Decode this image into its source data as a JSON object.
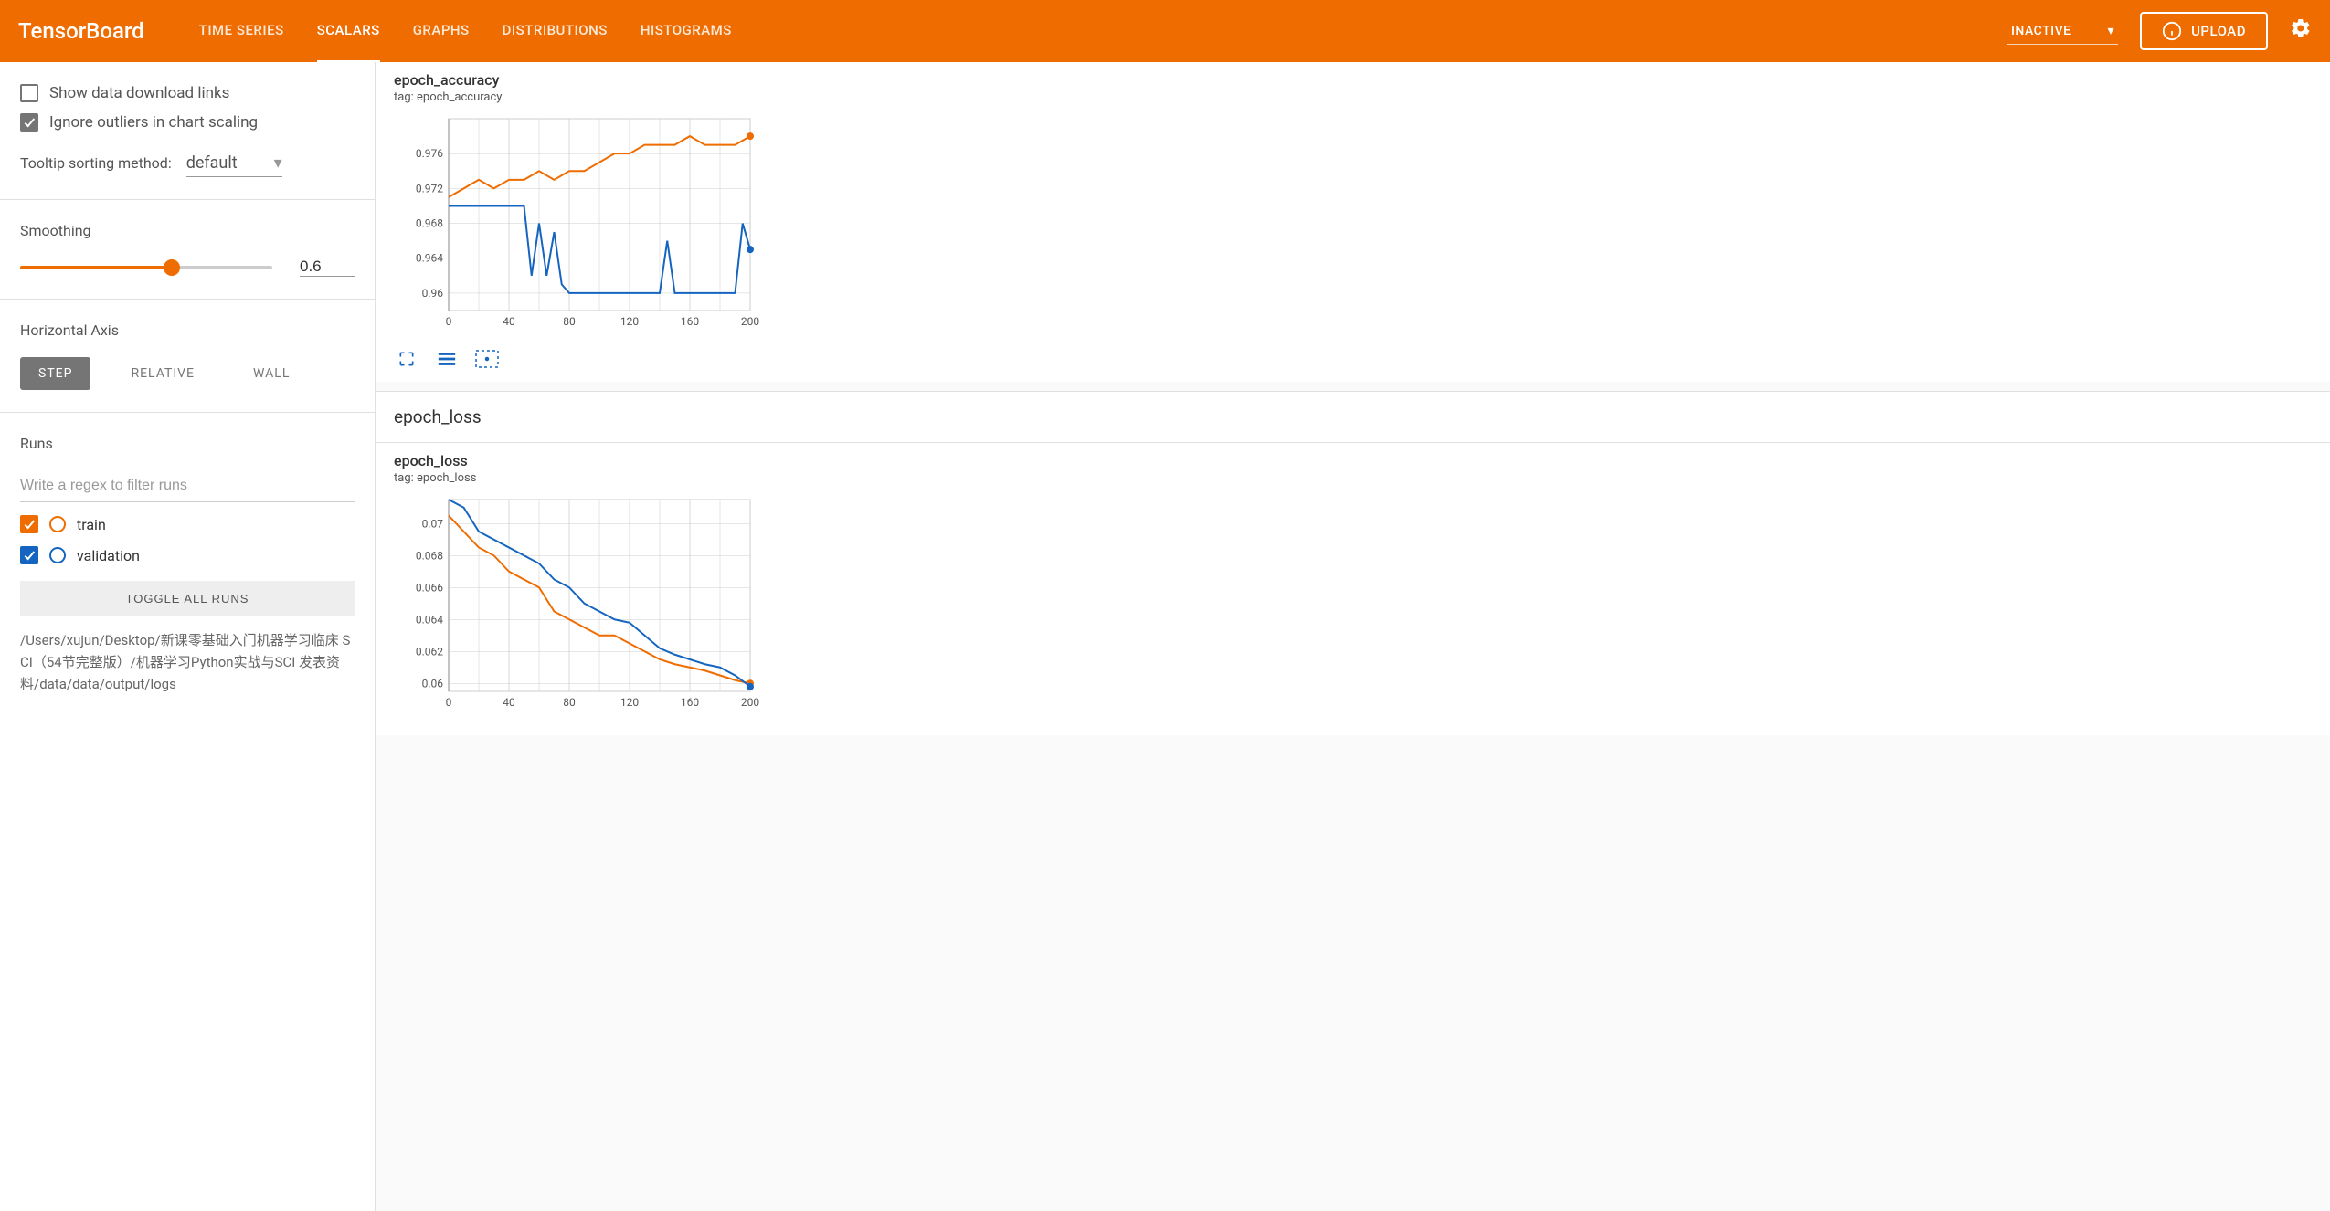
{
  "header": {
    "logo": "TensorBoard",
    "tabs": [
      "TIME SERIES",
      "SCALARS",
      "GRAPHS",
      "DISTRIBUTIONS",
      "HISTOGRAMS"
    ],
    "active_tab": "SCALARS",
    "status": "INACTIVE",
    "upload": "UPLOAD"
  },
  "sidebar": {
    "show_download": "Show data download links",
    "ignore_outliers": "Ignore outliers in chart scaling",
    "tooltip_label": "Tooltip sorting method:",
    "tooltip_value": "default",
    "smoothing_label": "Smoothing",
    "smoothing_value": "0.6",
    "haxis_label": "Horizontal Axis",
    "haxis_options": [
      "STEP",
      "RELATIVE",
      "WALL"
    ],
    "runs_label": "Runs",
    "filter_placeholder": "Write a regex to filter runs",
    "runs": [
      {
        "name": "train",
        "color": "#ef6c00"
      },
      {
        "name": "validation",
        "color": "#1565c0"
      }
    ],
    "toggle_all": "TOGGLE ALL RUNS",
    "path": "/Users/xujun/Desktop/新课零基础入门机器学习临床 SCI（54节完整版）/机器学习Python实战与SCI 发表资料/data/data/output/logs"
  },
  "charts": {
    "accuracy": {
      "title": "epoch_accuracy",
      "tag": "tag: epoch_accuracy"
    },
    "loss_section": "epoch_loss",
    "loss": {
      "title": "epoch_loss",
      "tag": "tag: epoch_loss"
    }
  },
  "chart_data": [
    {
      "type": "line",
      "title": "epoch_accuracy",
      "xlabel": "",
      "ylabel": "",
      "x_ticks": [
        0,
        40,
        80,
        120,
        160,
        200
      ],
      "y_ticks": [
        0.96,
        0.964,
        0.968,
        0.972,
        0.976
      ],
      "xlim": [
        0,
        200
      ],
      "ylim": [
        0.958,
        0.98
      ],
      "series": [
        {
          "name": "train",
          "color": "#ef6c00",
          "x": [
            0,
            10,
            20,
            30,
            40,
            50,
            60,
            70,
            80,
            90,
            100,
            110,
            120,
            130,
            140,
            150,
            160,
            170,
            180,
            190,
            200
          ],
          "y": [
            0.971,
            0.972,
            0.973,
            0.972,
            0.973,
            0.973,
            0.974,
            0.973,
            0.974,
            0.974,
            0.975,
            0.976,
            0.976,
            0.977,
            0.977,
            0.977,
            0.978,
            0.977,
            0.977,
            0.977,
            0.978
          ]
        },
        {
          "name": "validation",
          "color": "#1565c0",
          "x": [
            0,
            10,
            20,
            30,
            40,
            50,
            55,
            60,
            65,
            70,
            75,
            80,
            90,
            100,
            110,
            120,
            130,
            140,
            145,
            150,
            160,
            170,
            180,
            190,
            195,
            200
          ],
          "y": [
            0.97,
            0.97,
            0.97,
            0.97,
            0.97,
            0.97,
            0.962,
            0.968,
            0.962,
            0.967,
            0.961,
            0.96,
            0.96,
            0.96,
            0.96,
            0.96,
            0.96,
            0.96,
            0.966,
            0.96,
            0.96,
            0.96,
            0.96,
            0.96,
            0.968,
            0.965
          ]
        }
      ]
    },
    {
      "type": "line",
      "title": "epoch_loss",
      "xlabel": "",
      "ylabel": "",
      "x_ticks": [
        0,
        40,
        80,
        120,
        160,
        200
      ],
      "y_ticks": [
        0.06,
        0.062,
        0.064,
        0.066,
        0.068,
        0.07
      ],
      "xlim": [
        0,
        200
      ],
      "ylim": [
        0.0595,
        0.0715
      ],
      "series": [
        {
          "name": "train",
          "color": "#ef6c00",
          "x": [
            0,
            10,
            20,
            30,
            40,
            50,
            60,
            70,
            80,
            90,
            100,
            110,
            120,
            130,
            140,
            150,
            160,
            170,
            180,
            190,
            200
          ],
          "y": [
            0.0705,
            0.0695,
            0.0685,
            0.068,
            0.067,
            0.0665,
            0.066,
            0.0645,
            0.064,
            0.0635,
            0.063,
            0.063,
            0.0625,
            0.062,
            0.0615,
            0.0612,
            0.061,
            0.0608,
            0.0605,
            0.0602,
            0.06
          ]
        },
        {
          "name": "validation",
          "color": "#1565c0",
          "x": [
            0,
            10,
            20,
            30,
            40,
            50,
            60,
            70,
            80,
            90,
            100,
            110,
            120,
            130,
            140,
            150,
            160,
            170,
            180,
            190,
            200
          ],
          "y": [
            0.0715,
            0.071,
            0.0695,
            0.069,
            0.0685,
            0.068,
            0.0675,
            0.0665,
            0.066,
            0.065,
            0.0645,
            0.064,
            0.0638,
            0.063,
            0.0622,
            0.0618,
            0.0615,
            0.0612,
            0.061,
            0.0605,
            0.0598
          ]
        }
      ]
    }
  ]
}
